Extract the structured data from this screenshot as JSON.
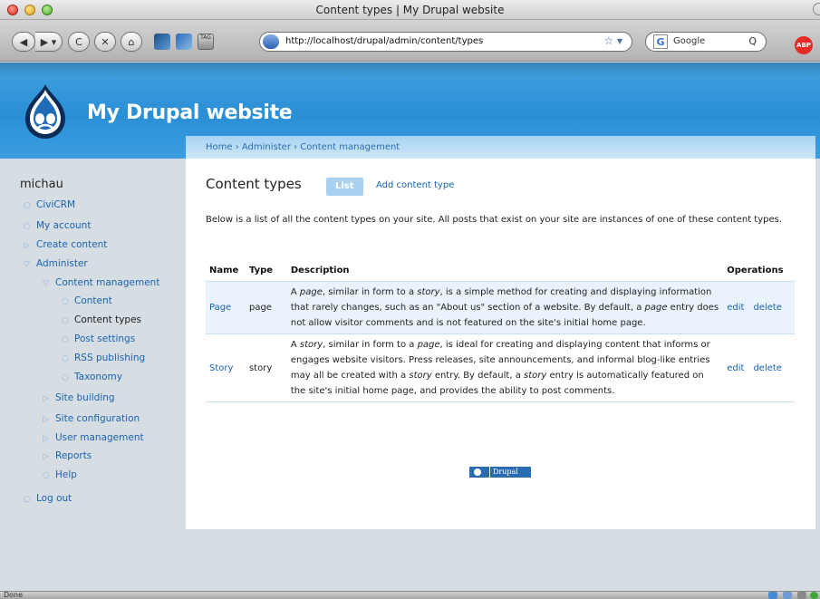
{
  "window": {
    "title": "Content types | My Drupal website"
  },
  "toolbar": {
    "back_label": "◀",
    "forward_label": "▶ ▾",
    "reload_label": "C",
    "stop_label": "✕",
    "home_label": "⌂",
    "tag_label": "TAG",
    "url": "http://localhost/drupal/admin/content/types",
    "bookmark_star": "☆ ▾",
    "search_engine_glyph": "G",
    "search_placeholder": "Google",
    "search_glyph": "Q",
    "adblock_label": "ABP"
  },
  "site": {
    "name": "My Drupal website",
    "breadcrumb": "Home › Administer › Content management"
  },
  "sidebar": {
    "username": "michau",
    "items": [
      {
        "label": "CiviCRM",
        "bullet": "○"
      },
      {
        "label": "My account",
        "bullet": "○"
      },
      {
        "label": "Create content",
        "bullet": "▷"
      },
      {
        "label": "Administer",
        "bullet": "▽"
      },
      {
        "label": "Content management",
        "bullet": "▽"
      },
      {
        "label": "Content",
        "bullet": "○"
      },
      {
        "label": "Content types",
        "bullet": "○"
      },
      {
        "label": "Post settings",
        "bullet": "○"
      },
      {
        "label": "RSS publishing",
        "bullet": "○"
      },
      {
        "label": "Taxonomy",
        "bullet": "○"
      },
      {
        "label": "Site building",
        "bullet": "▷"
      },
      {
        "label": "Site configuration",
        "bullet": "▷"
      },
      {
        "label": "User management",
        "bullet": "▷"
      },
      {
        "label": "Reports",
        "bullet": "▷"
      },
      {
        "label": "Help",
        "bullet": "○"
      },
      {
        "label": "Log out",
        "bullet": "○"
      }
    ]
  },
  "main": {
    "title": "Content types",
    "tabs": {
      "list": "List",
      "add": "Add content type"
    },
    "intro": "Below is a list of all the content types on your site. All posts that exist on your site are instances of one of these content types.",
    "table": {
      "headers": {
        "name": "Name",
        "type": "Type",
        "description": "Description",
        "operations": "Operations"
      },
      "rows": [
        {
          "name": "Page",
          "type": "page",
          "desc": {
            "p1": "A ",
            "i1": "page",
            "p2": ", similar in form to a ",
            "i2": "story",
            "p3": ", is a simple method for creating and displaying information that rarely changes, such as an \"About us\" section of a website. By default, a ",
            "i3": "page",
            "p4": " entry does not allow visitor comments and is not featured on the site's initial home page."
          },
          "edit": "edit",
          "delete": "delete"
        },
        {
          "name": "Story",
          "type": "story",
          "desc": {
            "p1": "A ",
            "i1": "story",
            "p2": ", similar in form to a ",
            "i2": "page",
            "p3": ", is ideal for creating and displaying content that informs or engages website visitors. Press releases, site announcements, and informal blog-like entries may all be created with a ",
            "i3": "story",
            "p4": " entry. By default, a ",
            "i4": "story",
            "p5": " entry is automatically featured on the site's initial home page, and provides the ability to post comments."
          },
          "edit": "edit",
          "delete": "delete"
        }
      ]
    },
    "powered_by": "Drupal"
  },
  "statusbar": {
    "text": "Done"
  },
  "colors": {
    "header_blue": "#2a8fd6",
    "link_blue": "#1a63b0",
    "row_highlight": "#eaf3fb"
  }
}
